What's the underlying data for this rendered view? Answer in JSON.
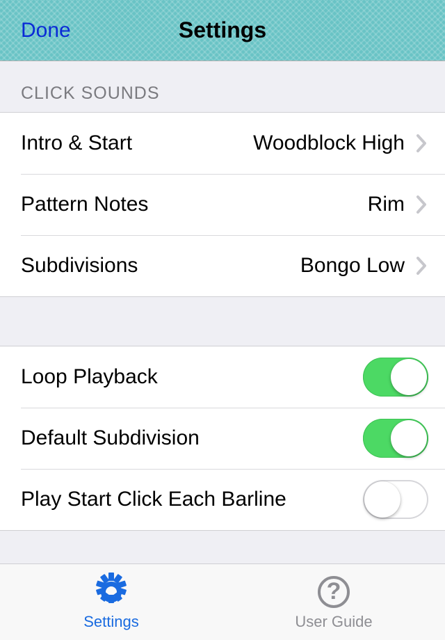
{
  "header": {
    "done": "Done",
    "title": "Settings"
  },
  "section1": {
    "title": "CLICK SOUNDS",
    "rows": [
      {
        "label": "Intro & Start",
        "value": "Woodblock High"
      },
      {
        "label": "Pattern Notes",
        "value": "Rim"
      },
      {
        "label": "Subdivisions",
        "value": "Bongo Low"
      }
    ]
  },
  "section2": {
    "rows": [
      {
        "label": "Loop Playback",
        "on": true
      },
      {
        "label": "Default Subdivision",
        "on": true
      },
      {
        "label": "Play Start Click Each Barline",
        "on": false
      }
    ]
  },
  "tabs": {
    "settings": "Settings",
    "guide": "User Guide"
  }
}
